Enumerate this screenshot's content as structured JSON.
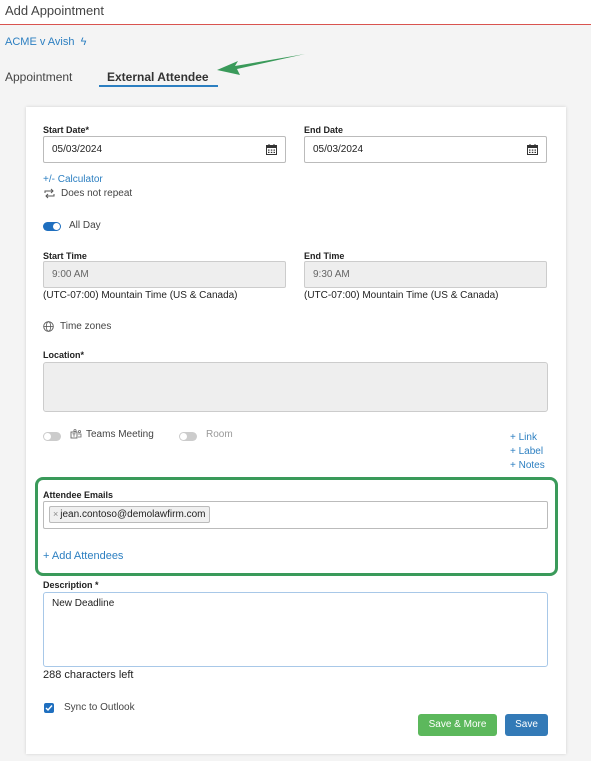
{
  "header": {
    "title": "Add Appointment"
  },
  "matter": {
    "name": "ACME v Avish"
  },
  "tabs": [
    {
      "label": "Appointment"
    },
    {
      "label": "External Attendee"
    }
  ],
  "form": {
    "start_date": {
      "label": "Start Date*",
      "value": "05/03/2024"
    },
    "end_date": {
      "label": "End Date",
      "value": "05/03/2024"
    },
    "calculator_link": "+/- Calculator",
    "repeat_text": "Does not repeat",
    "all_day": {
      "label": "All Day",
      "on": true
    },
    "start_time": {
      "label": "Start Time",
      "value": "9:00 AM",
      "timezone": "(UTC-07:00) Mountain Time (US & Canada)"
    },
    "end_time": {
      "label": "End Time",
      "value": "9:30 AM",
      "timezone": "(UTC-07:00) Mountain Time (US & Canada)"
    },
    "time_zones_label": "Time zones",
    "location": {
      "label": "Location*",
      "value": ""
    },
    "teams_meeting": {
      "label": "Teams Meeting",
      "on": false
    },
    "room": {
      "label": "Room",
      "on": false
    },
    "links": {
      "link": "+ Link",
      "label": "+ Label",
      "notes": "+ Notes"
    },
    "attendees": {
      "label": "Attendee Emails",
      "emails": [
        "jean.contoso@demolawfirm.com"
      ],
      "add_link": "+ Add Attendees"
    },
    "description": {
      "label": "Description *",
      "value": "New Deadline",
      "chars_left": "288 characters left"
    },
    "sync": {
      "label": "Sync to Outlook",
      "checked": true
    }
  },
  "buttons": {
    "save_more": "Save & More",
    "save": "Save"
  },
  "colors": {
    "accent": "#2c7fc1",
    "highlight": "#3a9a5a",
    "save_more": "#5cb85c",
    "save": "#337ab7",
    "header_line": "#d9534f"
  }
}
